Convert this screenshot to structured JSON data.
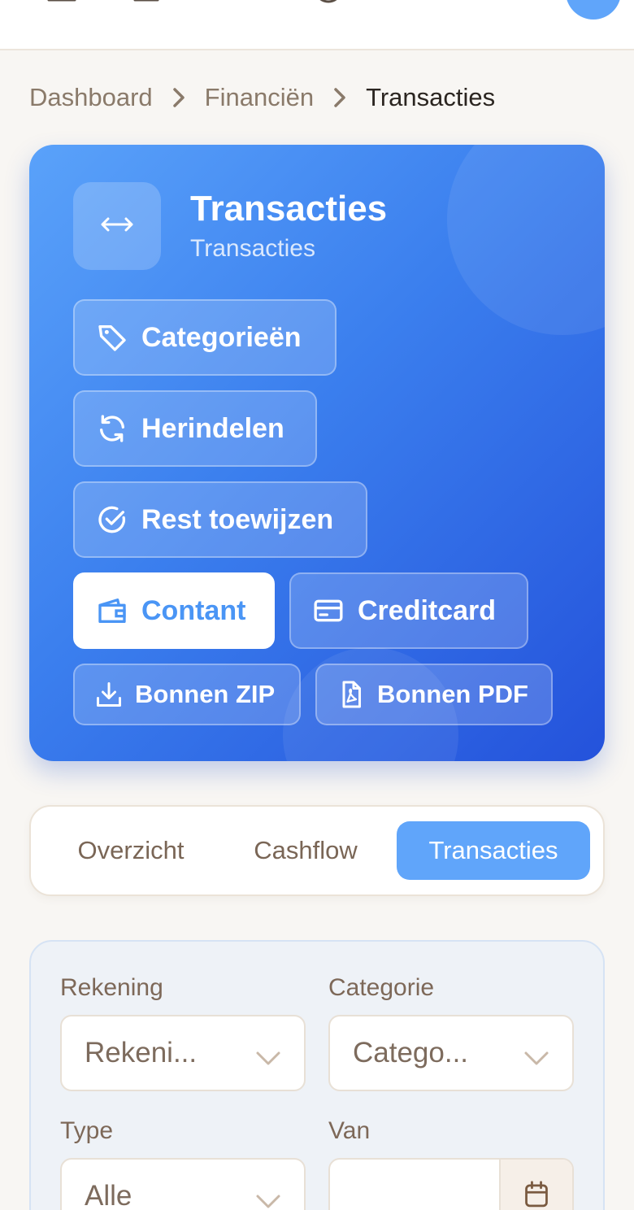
{
  "topbar": {
    "icons": [
      "menu-icon",
      "building-icon",
      "search-icon",
      "clock-icon",
      "user-icon"
    ],
    "avatar_color": "#60a5fa"
  },
  "breadcrumb": {
    "items": [
      "Dashboard",
      "Financiën",
      "Transacties"
    ]
  },
  "hero": {
    "icon": "arrows-left-right-icon",
    "title": "Transacties",
    "subtitle": "Transacties",
    "gradient": [
      "#5aa2fa",
      "#2452db"
    ],
    "buttons": {
      "categories": "Categorieën",
      "reassign": "Herindelen",
      "assign_rest": "Rest toewijzen",
      "cash": "Contant",
      "creditcard": "Creditcard",
      "receipts_zip": "Bonnen ZIP",
      "receipts_pdf": "Bonnen PDF"
    }
  },
  "tabs": {
    "items": [
      "Overzicht",
      "Cashflow",
      "Transacties"
    ],
    "active": "Transacties",
    "active_color": "#60a5fa"
  },
  "filters": {
    "account": {
      "label": "Rekening",
      "placeholder": "Rekeni..."
    },
    "category": {
      "label": "Categorie",
      "placeholder": "Catego..."
    },
    "type": {
      "label": "Type",
      "value": "Alle"
    },
    "from": {
      "label": "Van",
      "value": ""
    }
  }
}
